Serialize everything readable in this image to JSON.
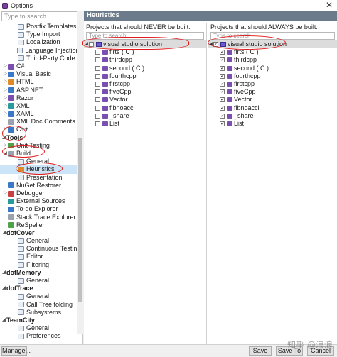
{
  "window": {
    "title": "Options",
    "close_glyph": "✕"
  },
  "sidebar": {
    "search_placeholder": "Type to search",
    "items": [
      {
        "label": "Postfix Templates",
        "icon": "doc-icon",
        "level": 1
      },
      {
        "label": "Type Import",
        "icon": "doc-icon",
        "level": 1
      },
      {
        "label": "Localization",
        "icon": "doc-icon",
        "level": 1
      },
      {
        "label": "Language Injections",
        "icon": "doc-icon",
        "level": 1
      },
      {
        "label": "Third-Party Code",
        "icon": "doc-icon",
        "level": 1
      },
      {
        "label": "C#",
        "icon": "csharp-icon",
        "level": 0,
        "expandable": true
      },
      {
        "label": "Visual Basic",
        "icon": "vb-icon",
        "level": 0,
        "expandable": true
      },
      {
        "label": "HTML",
        "icon": "html-icon",
        "level": 0,
        "expandable": true
      },
      {
        "label": "ASP.NET",
        "icon": "aspnet-icon",
        "level": 0,
        "expandable": true
      },
      {
        "label": "Razor",
        "icon": "razor-icon",
        "level": 0,
        "expandable": true
      },
      {
        "label": "XML",
        "icon": "xml-icon",
        "level": 0,
        "expandable": true
      },
      {
        "label": "XAML",
        "icon": "xaml-icon",
        "level": 0,
        "expandable": true
      },
      {
        "label": "XML Doc Comments",
        "icon": "xmldoc-icon",
        "level": 0
      },
      {
        "label": "C++",
        "icon": "cpp-icon",
        "level": 0,
        "expandable": true
      }
    ],
    "tools_group": "Tools",
    "tools_items": [
      {
        "label": "Unit Testing",
        "icon": "unit-testing-icon",
        "level": 0,
        "expandable": true
      },
      {
        "label": "Build",
        "icon": "build-icon",
        "level": 0,
        "expanded": true
      },
      {
        "label": "General",
        "icon": "doc-icon",
        "level": 1
      },
      {
        "label": "Heuristics",
        "icon": "heuristics-icon",
        "level": 1,
        "selected": true
      },
      {
        "label": "Presentation",
        "icon": "doc-icon",
        "level": 1
      },
      {
        "label": "NuGet Restorer",
        "icon": "nuget-icon",
        "level": 0
      },
      {
        "label": "Debugger",
        "icon": "debugger-icon",
        "level": 0,
        "expandable": true
      },
      {
        "label": "External Sources",
        "icon": "external-icon",
        "level": 0
      },
      {
        "label": "To-do Explorer",
        "icon": "todo-icon",
        "level": 0
      },
      {
        "label": "Stack Trace Explorer",
        "icon": "stacktrace-icon",
        "level": 0
      },
      {
        "label": "ReSpeller",
        "icon": "respeller-icon",
        "level": 0
      }
    ],
    "dotcover_group": "dotCover",
    "dotcover_items": [
      "General",
      "Continuous Testing",
      "Editor",
      "Filtering"
    ],
    "dotmemory_group": "dotMemory",
    "dotmemory_items": [
      "General"
    ],
    "dottrace_group": "dotTrace",
    "dottrace_items": [
      "General",
      "Call Tree folding",
      "Subsystems"
    ],
    "teamcity_group": "TeamCity",
    "teamcity_items": [
      "General",
      "Preferences"
    ]
  },
  "content": {
    "header": "Heuristics",
    "never": {
      "caption": "Projects that should NEVER be built:",
      "search_placeholder": "Type to search",
      "solution": "visual studio solution",
      "projects": [
        "firts ( C )",
        "thirdcpp",
        "second ( C )",
        "fourthcpp",
        "firstcpp",
        "fiveCpp",
        "Vector",
        "fibnoacci",
        "_share",
        "List"
      ]
    },
    "always": {
      "caption": "Projects that should ALWAYS be built:",
      "search_placeholder": "Type to search",
      "solution": "visual studio solution",
      "projects": [
        "firts ( C )",
        "thirdcpp",
        "second ( C )",
        "fourthcpp",
        "firstcpp",
        "fiveCpp",
        "Vector",
        "fibnoacci",
        "_share",
        "List"
      ]
    }
  },
  "footer": {
    "manage": "Manage...",
    "save": "Save",
    "save_to": "Save To",
    "cancel": "Cancel",
    "watermark": "知乎 @浪浪"
  }
}
